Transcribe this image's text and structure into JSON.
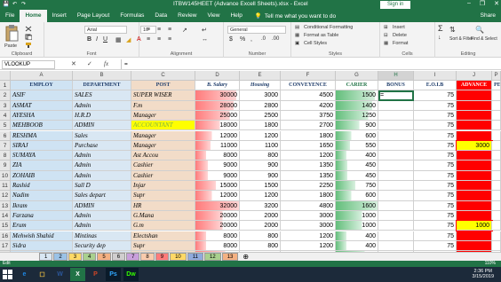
{
  "titlebar": {
    "title": "ITBW145HEET (Advance Excell Sheets).xlsx - Excel",
    "signin": "Sign in",
    "minimize": "–",
    "restore": "❐",
    "close": "✕"
  },
  "tabs": [
    "File",
    "Home",
    "Insert",
    "Page Layout",
    "Formulas",
    "Data",
    "Review",
    "View",
    "Help"
  ],
  "tell_me": "Tell me what you want to do",
  "share": "Share",
  "ribbon": {
    "paste": "Paste",
    "clipboard": "Clipboard",
    "font_name": "Arial",
    "font_size": "10",
    "font": "Font",
    "alignment": "Alignment",
    "number_format": "General",
    "number": "Number",
    "conditional_formatting": "Conditional Formatting",
    "format_as_table": "Format as Table",
    "cell_styles": "Cell Styles",
    "styles": "Styles",
    "insert": "Insert",
    "delete": "Delete",
    "format": "Format",
    "cells": "Cells",
    "sort_filter": "Sort & Filter",
    "find_select": "Find & Select",
    "editing": "Editing"
  },
  "formula_bar": {
    "name_box": "VLOOKUP",
    "formula": "="
  },
  "columns": [
    "A",
    "B",
    "C",
    "D",
    "E",
    "F",
    "G",
    "H",
    "I",
    "J",
    "P"
  ],
  "headers": [
    "EMPLOY",
    "DEPARTMENT",
    "POST",
    "B. Salary",
    "Housing",
    "CONVEYENCE",
    "CARIER",
    "BONUS",
    "E.O.I.B",
    "ADVANCE",
    "PE"
  ],
  "rows": [
    {
      "n": "2",
      "c": [
        "ASIF",
        "SALES",
        "SUPER WISER",
        "30000",
        "3000",
        "4500",
        "1500",
        "=",
        "75",
        "",
        ""
      ]
    },
    {
      "n": "3",
      "c": [
        "ASMAT",
        "Admin",
        "F.m",
        "28000",
        "2800",
        "4200",
        "1400",
        "",
        "75",
        "",
        ""
      ]
    },
    {
      "n": "4",
      "c": [
        "AYESHA",
        "H.R.D",
        "Manager",
        "25000",
        "2500",
        "3750",
        "1250",
        "",
        "75",
        "",
        ""
      ]
    },
    {
      "n": "5",
      "c": [
        "MEHBOOB",
        "ADMIN",
        "ACCOUNTANT",
        "18000",
        "1800",
        "2700",
        "900",
        "",
        "75",
        "",
        ""
      ]
    },
    {
      "n": "6",
      "c": [
        "RESHMA",
        "Sales",
        "Manager",
        "12000",
        "1200",
        "1800",
        "600",
        "",
        "75",
        "",
        ""
      ]
    },
    {
      "n": "7",
      "c": [
        "SIRAJ",
        "Purchase",
        "Manager",
        "11000",
        "1100",
        "1650",
        "550",
        "",
        "75",
        "3000",
        ""
      ]
    },
    {
      "n": "8",
      "c": [
        "SUMAYA",
        "Admin",
        "Ast Accou",
        "8000",
        "800",
        "1200",
        "400",
        "",
        "75",
        "",
        ""
      ]
    },
    {
      "n": "9",
      "c": [
        "ZIA",
        "Admin",
        "Cashier",
        "9000",
        "900",
        "1350",
        "450",
        "",
        "75",
        "",
        ""
      ]
    },
    {
      "n": "10",
      "c": [
        "ZOHAIB",
        "Admin",
        "Cashier",
        "9000",
        "900",
        "1350",
        "450",
        "",
        "75",
        "",
        ""
      ]
    },
    {
      "n": "11",
      "c": [
        "Rashid",
        "Sall D",
        "Injar",
        "15000",
        "1500",
        "2250",
        "750",
        "",
        "75",
        "",
        ""
      ]
    },
    {
      "n": "12",
      "c": [
        "Nadim",
        "Sales depart",
        "Supr",
        "12000",
        "1200",
        "1800",
        "600",
        "",
        "75",
        "",
        ""
      ]
    },
    {
      "n": "13",
      "c": [
        "Ikram",
        "ADMIN",
        "HR",
        "32000",
        "3200",
        "4800",
        "1600",
        "",
        "75",
        "",
        ""
      ]
    },
    {
      "n": "14",
      "c": [
        "Farzana",
        "Admin",
        "G.Mana",
        "20000",
        "2000",
        "3000",
        "1000",
        "",
        "75",
        "",
        ""
      ]
    },
    {
      "n": "15",
      "c": [
        "Erum",
        "Admin",
        "G.m",
        "20000",
        "2000",
        "3000",
        "1000",
        "",
        "75",
        "1000",
        ""
      ]
    },
    {
      "n": "16",
      "c": [
        "Mehwish Shahid",
        "Mintinas",
        "Electshan",
        "8000",
        "800",
        "1200",
        "400",
        "",
        "75",
        "",
        ""
      ]
    },
    {
      "n": "17",
      "c": [
        "Sidra",
        "Security dep",
        "Supr",
        "8000",
        "800",
        "1200",
        "400",
        "",
        "75",
        "",
        ""
      ]
    },
    {
      "n": "18",
      "c": [
        "Shabana",
        "Admin",
        "G.M",
        "22000",
        "2200",
        "3300",
        "1100",
        "",
        "75",
        "",
        ""
      ]
    }
  ],
  "sheet_tabs": [
    "1",
    "2",
    "3",
    "4",
    "5",
    "6",
    "7",
    "8",
    "9",
    "10",
    "11",
    "12",
    "13"
  ],
  "status": "Edit",
  "zoom": "110%",
  "taskbar_apps": [
    "e",
    "☐",
    "W",
    "X",
    "P",
    "Ps",
    "Dw"
  ],
  "clock": {
    "time": "2:36 PM",
    "date": "3/15/2019"
  },
  "colors": {
    "excel_green": "#217346",
    "col_a": "#cfe3f3",
    "col_b": "#d9e7f3",
    "col_c": "#f2dcc8",
    "col_h": "#ffffff",
    "col_j": "#ff0000",
    "accent_yellow": "#ffff00",
    "bar_red": "#ff7b7b",
    "bar_green": "#63be7b"
  }
}
